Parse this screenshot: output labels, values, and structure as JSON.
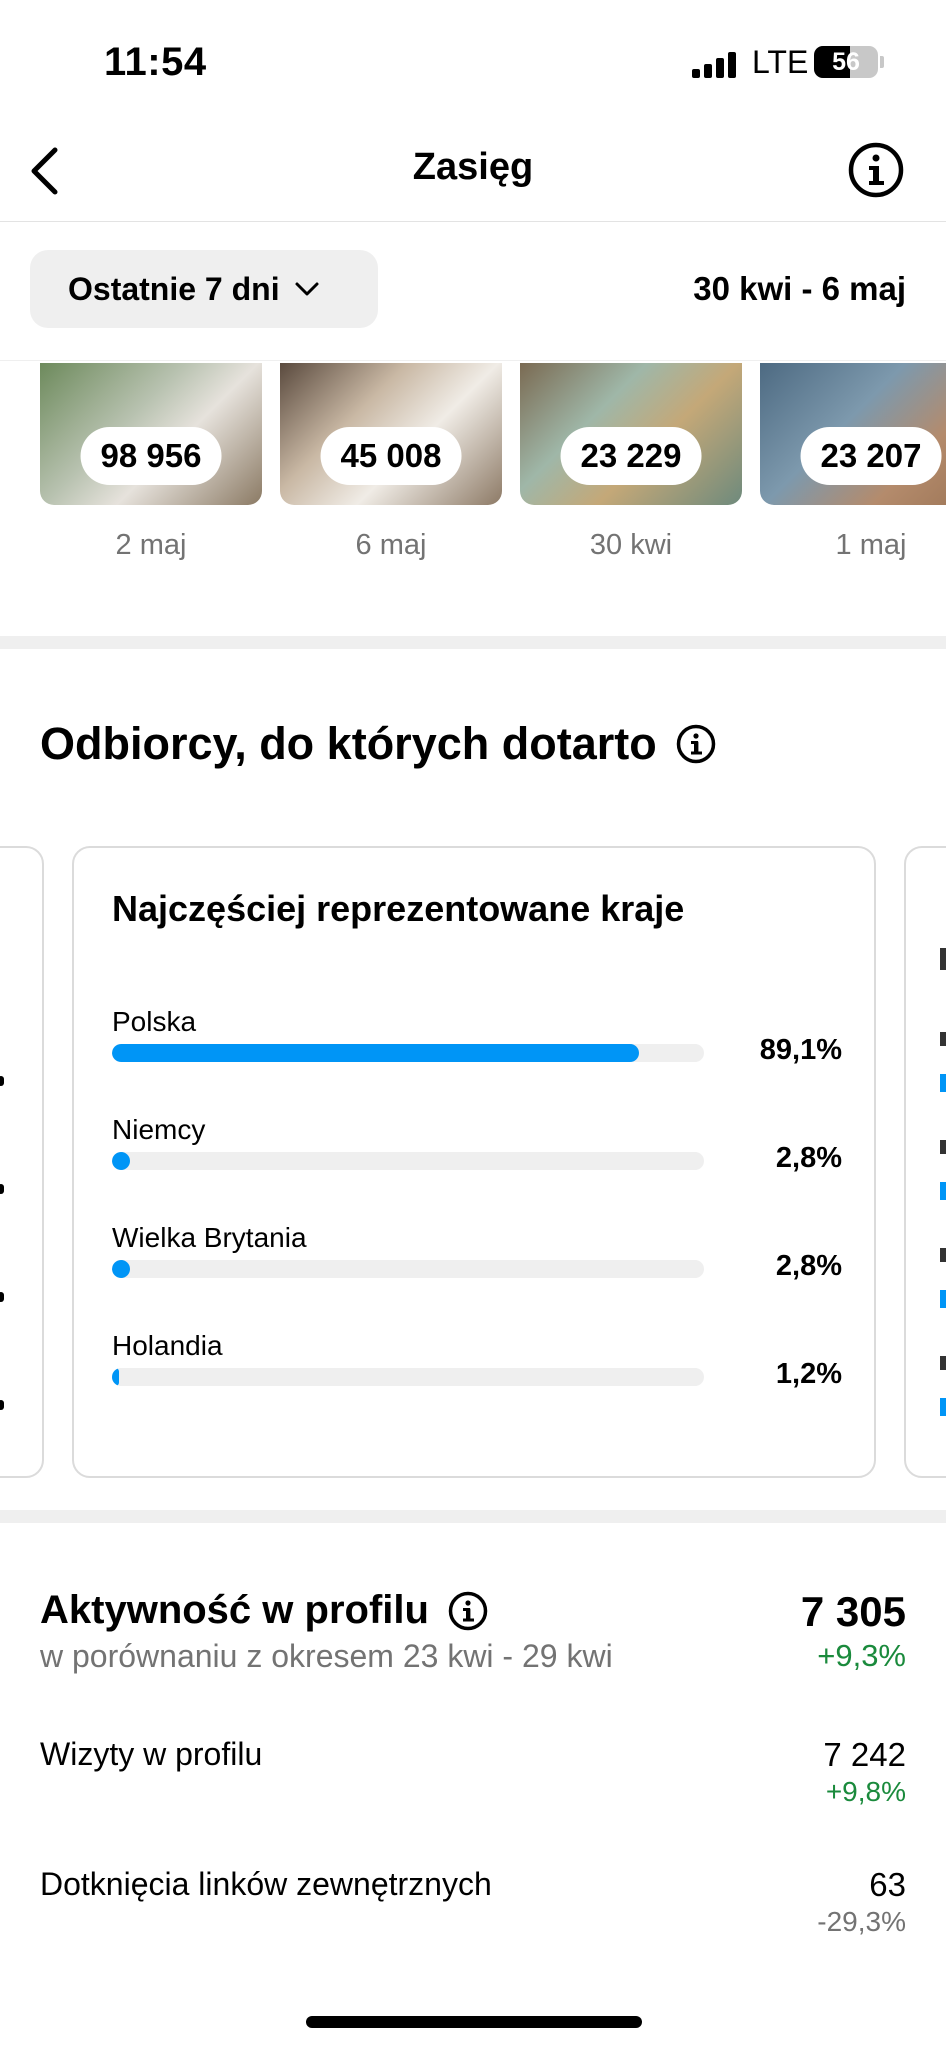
{
  "status_bar": {
    "time": "11:54",
    "network": "LTE",
    "battery": "56",
    "battery_level": 0.56
  },
  "nav": {
    "title": "Zasięg"
  },
  "filter": {
    "period_label": "Ostatnie 7 dni",
    "date_range": "30 kwi - 6 maj"
  },
  "top_content": [
    {
      "count": "98 956",
      "date": "2 maj"
    },
    {
      "count": "45 008",
      "date": "6 maj"
    },
    {
      "count": "23 229",
      "date": "30 kwi"
    },
    {
      "count": "23 207",
      "date": "1 maj"
    }
  ],
  "audience": {
    "title": "Odbiorcy, do których dotarto",
    "card": {
      "title": "Najczęściej reprezentowane kraje",
      "countries": [
        {
          "name": "Polska",
          "percent_label": "89,1%",
          "fraction": 0.891
        },
        {
          "name": "Niemcy",
          "percent_label": "2,8%",
          "fraction": 0.028
        },
        {
          "name": "Wielka Brytania",
          "percent_label": "2,8%",
          "fraction": 0.028
        },
        {
          "name": "Holandia",
          "percent_label": "1,2%",
          "fraction": 0.012
        }
      ]
    }
  },
  "profile_activity": {
    "title": "Aktywność w profilu",
    "comparison": "w porównaniu z okresem 23 kwi - 29 kwi",
    "total": "7 305",
    "total_change": "+9,3%",
    "metrics": [
      {
        "label": "Wizyty w profilu",
        "value": "7 242",
        "change": "+9,8%",
        "trend": "up"
      },
      {
        "label": "Dotknięcia linków zewnętrznych",
        "value": "63",
        "change": "-29,3%",
        "trend": "down"
      }
    ]
  },
  "colors": {
    "accent_blue": "#0095f6",
    "positive_green": "#1a8a3c",
    "secondary_gray": "#737373"
  }
}
